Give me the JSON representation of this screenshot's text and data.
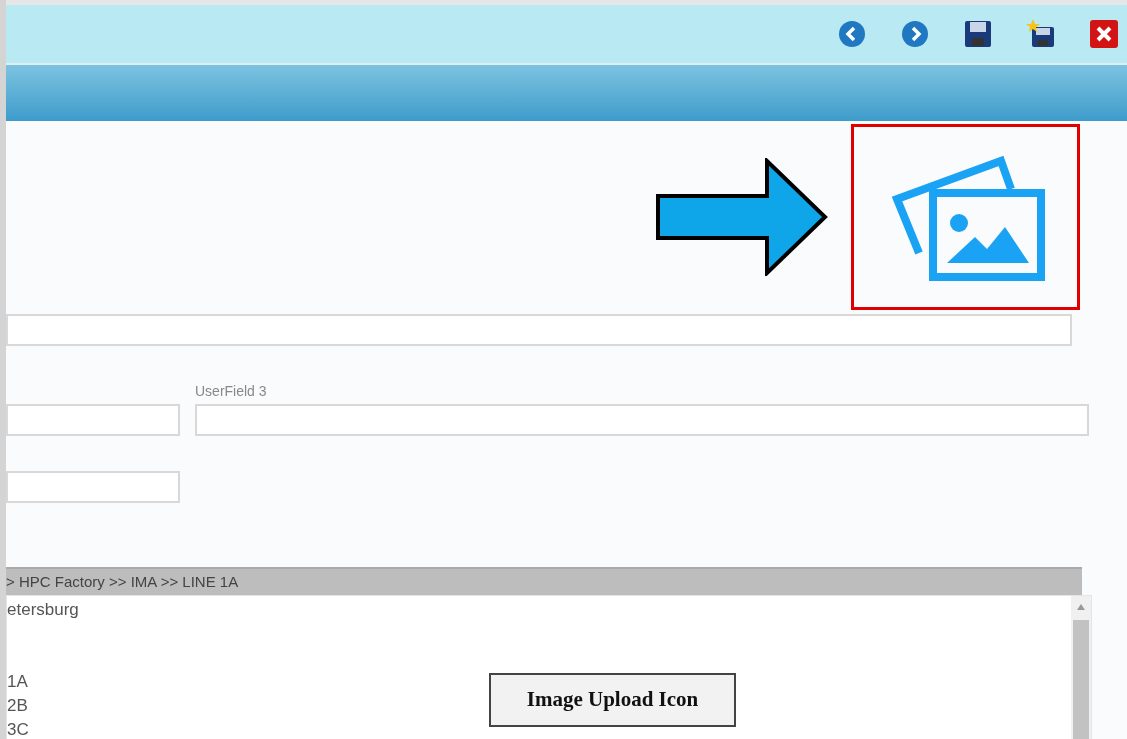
{
  "toolbar": {
    "buttons": [
      {
        "kind": "back"
      },
      {
        "kind": "forward"
      },
      {
        "kind": "save"
      },
      {
        "kind": "save-new"
      },
      {
        "kind": "close"
      }
    ]
  },
  "form": {
    "rows": [
      {
        "fields": [
          {
            "kind": "full"
          }
        ]
      },
      {
        "fields": [
          {
            "kind": "short"
          },
          {
            "kind": "wide",
            "label": "UserField 3"
          }
        ]
      },
      {
        "fields": [
          {
            "kind": "short"
          }
        ]
      }
    ]
  },
  "tree": {
    "path": "> HPC Factory >> IMA >> LINE 1A",
    "items": [
      "etersburg",
      "1A",
      "2B",
      "3C"
    ]
  },
  "annotation": {
    "caption": "Image Upload Icon"
  }
}
